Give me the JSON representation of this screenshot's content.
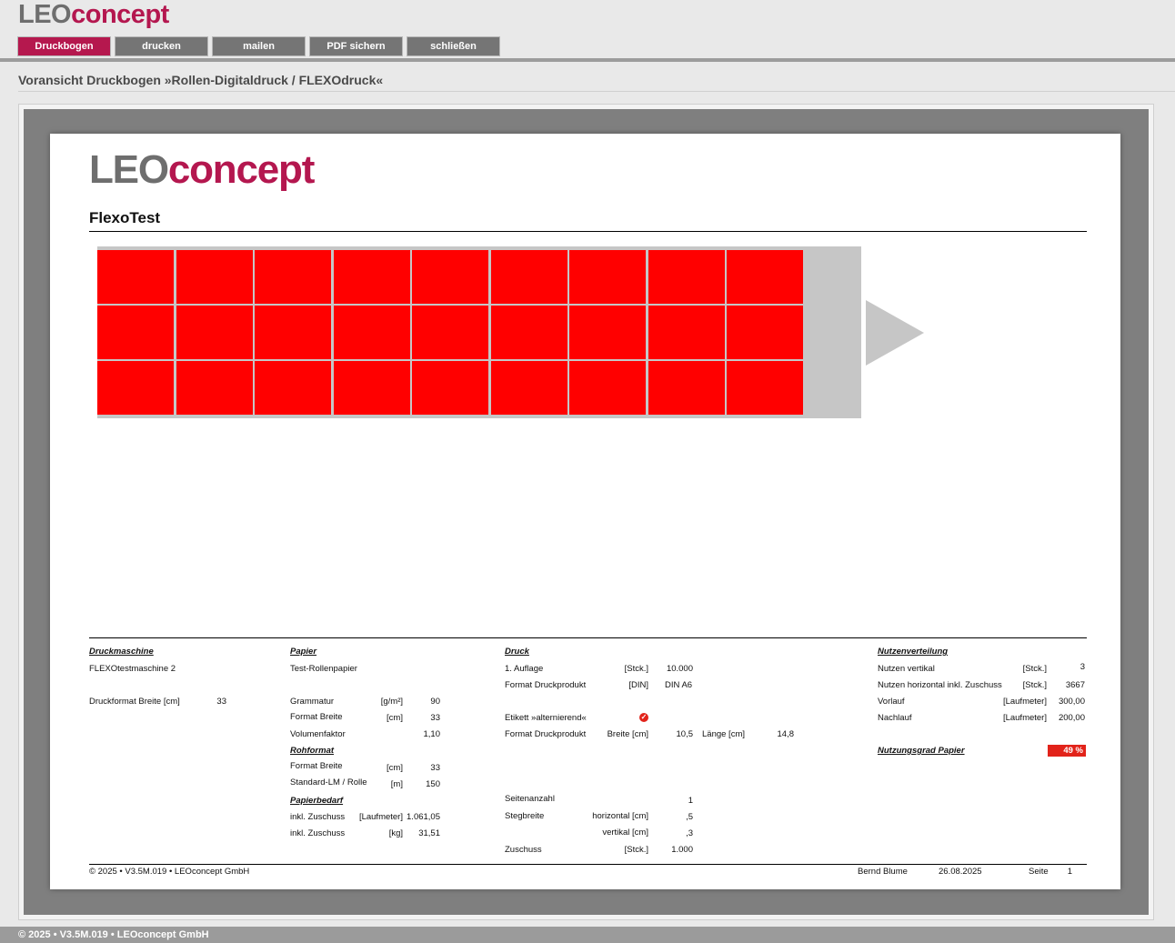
{
  "brand": {
    "leo": "LEO",
    "concept": "concept"
  },
  "toolbar": {
    "buttons": [
      {
        "label": "Druckbogen",
        "active": true
      },
      {
        "label": "drucken"
      },
      {
        "label": "mailen"
      },
      {
        "label": "PDF sichern"
      },
      {
        "label": "schließen"
      }
    ]
  },
  "page_subtitle": "Voransicht  Druckbogen »Rollen-Digitaldruck / FLEXOdruck«",
  "document": {
    "job_title": "FlexoTest",
    "layout": {
      "columns": 9,
      "rows": 3,
      "cell_color": "#ff0000",
      "roll_color": "#c6c6c6"
    },
    "druckmaschine": {
      "heading": "Druckmaschine",
      "name": "FLEXOtestmaschine 2",
      "breite_label": "Druckformat Breite [cm]",
      "breite_value": "33"
    },
    "papier": {
      "heading": "Papier",
      "name": "Test-Rollenpapier",
      "rows": [
        {
          "label": "Grammatur",
          "unit": "[g/m²]",
          "value": "90"
        },
        {
          "label": "Format Breite",
          "unit": "[cm]",
          "value": "33"
        },
        {
          "label": "Volumenfaktor",
          "unit": "",
          "value": "1,10"
        }
      ],
      "rohformat_heading": "Rohformat",
      "rohformat_rows": [
        {
          "label": "Format Breite",
          "unit": "[cm]",
          "value": "33"
        },
        {
          "label": "Standard-LM / Rolle",
          "unit": "[m]",
          "value": "150"
        }
      ],
      "bedarf_heading": "Papierbedarf",
      "bedarf_rows": [
        {
          "label": "inkl. Zuschuss",
          "unit": "[Laufmeter]",
          "value": "1.061,05"
        },
        {
          "label": "inkl. Zuschuss",
          "unit": "[kg]",
          "value": "31,51"
        }
      ]
    },
    "druck": {
      "heading": "Druck",
      "auflage_label": "1. Auflage",
      "auflage_unit": "[Stck.]",
      "auflage_value": "10.000",
      "format_label": "Format Druckprodukt",
      "format_unit": "[DIN]",
      "format_value": "DIN A6",
      "etikett_label": "Etikett »alternierend«",
      "format2_label": "Format Druckprodukt",
      "breite_label": "Breite [cm]",
      "breite_value": "10,5",
      "laenge_label": "Länge [cm]",
      "laenge_value": "14,8",
      "seiten_label": "Seitenanzahl",
      "seiten_value": "1",
      "steg_label": "Stegbreite",
      "steg_h_label": "horizontal [cm]",
      "steg_h_value": ",5",
      "steg_v_label": "vertikal [cm]",
      "steg_v_value": ",3",
      "zuschuss_label": "Zuschuss",
      "zuschuss_unit": "[Stck.]",
      "zuschuss_value": "1.000"
    },
    "nutzen": {
      "heading": "Nutzenverteilung",
      "rows": [
        {
          "label": "Nutzen vertikal",
          "unit": "[Stck.]",
          "value": "3"
        },
        {
          "label": "Nutzen horizontal inkl. Zuschuss",
          "unit": "[Stck.]",
          "value": "3667"
        },
        {
          "label": "Vorlauf",
          "unit": "[Laufmeter]",
          "value": "300,00"
        },
        {
          "label": "Nachlauf",
          "unit": "[Laufmeter]",
          "value": "200,00"
        }
      ],
      "grad_label": "Nutzungsgrad Papier",
      "grad_value": "49 %"
    },
    "footer": {
      "copyright": "© 2025 • V3.5M.019 • LEOconcept GmbH",
      "user": "Bernd Blume",
      "date": "26.08.2025",
      "page_label": "Seite",
      "page_value": "1"
    }
  },
  "status_bar": "© 2025 • V3.5M.019 • LEOconcept GmbH"
}
